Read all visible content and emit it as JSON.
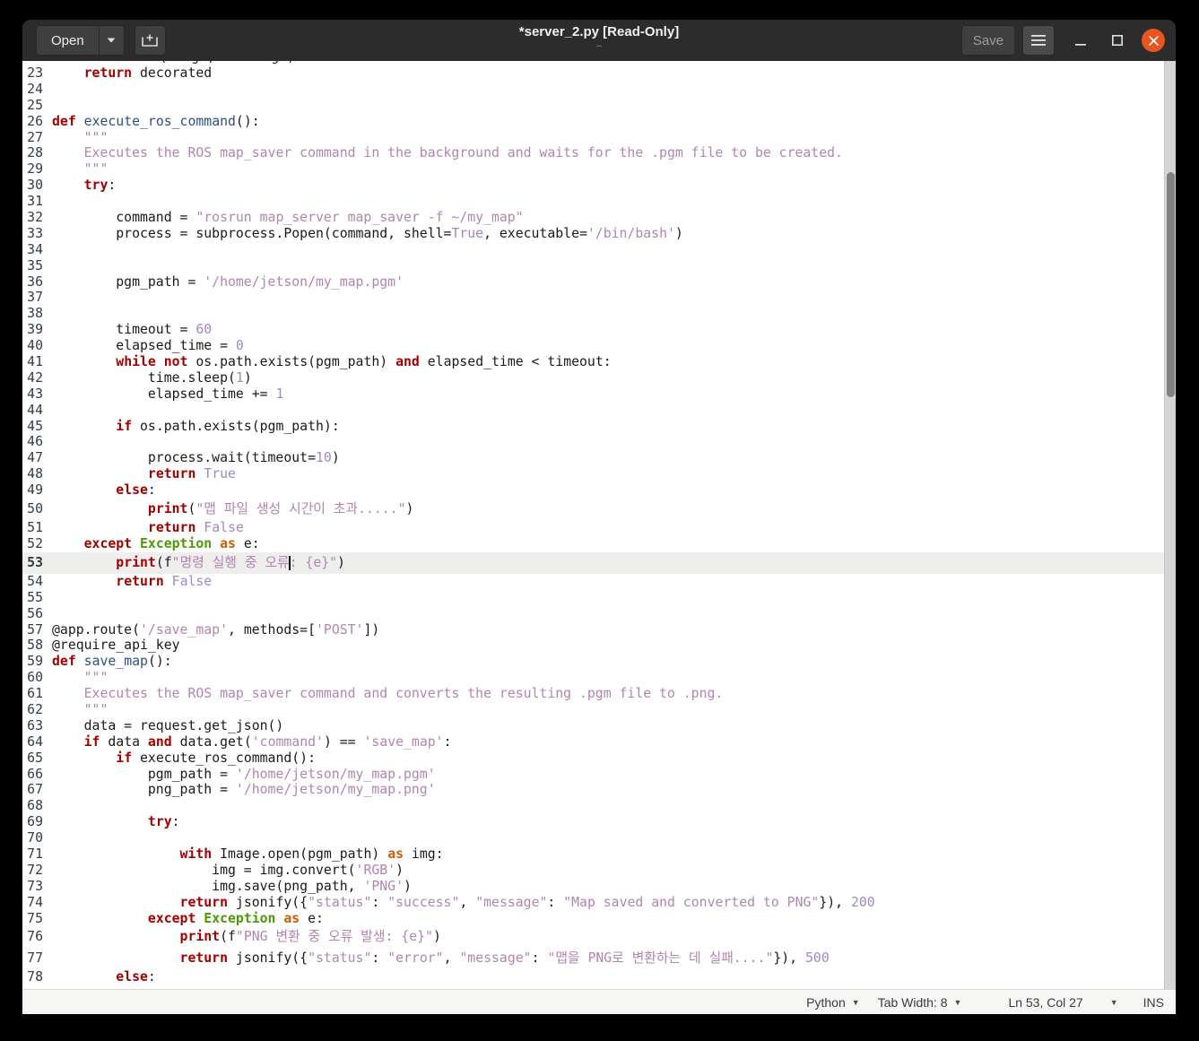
{
  "window": {
    "title": "*server_2.py [Read-Only]",
    "subtitle": "~"
  },
  "titlebar": {
    "open_label": "Open",
    "save_label": "Save"
  },
  "statusbar": {
    "language": "Python",
    "tab_width": "Tab Width: 8",
    "position": "Ln 53, Col 27",
    "mode": "INS"
  },
  "colors": {
    "titlebar_bg": "#2c2c2c",
    "close_button": "#e95420",
    "editor_bg": "#ffffff",
    "current_line_bg": "#eeeeec",
    "keyword": "#a40000",
    "string": "#b184b1",
    "number": "#a386c6",
    "exception": "#4e9a06",
    "as_keyword": "#ce5c00",
    "function_name": "#2a4f87"
  },
  "editor": {
    "current_line": 53,
    "partial_line": {
      "toks": [
        [
          "t",
          "        "
        ],
        [
          "k",
          "return"
        ],
        [
          "t",
          " f(*args, **kwargs)"
        ]
      ]
    },
    "lines": [
      {
        "n": 23,
        "toks": [
          [
            "t",
            "    "
          ],
          [
            "k",
            "return"
          ],
          [
            "t",
            " decorated"
          ]
        ]
      },
      {
        "n": 24,
        "toks": []
      },
      {
        "n": 25,
        "toks": []
      },
      {
        "n": 26,
        "toks": [
          [
            "k",
            "def"
          ],
          [
            "t",
            " "
          ],
          [
            "f",
            "execute_ros_command"
          ],
          [
            "t",
            "():"
          ]
        ]
      },
      {
        "n": 27,
        "toks": [
          [
            "t",
            "    "
          ],
          [
            "s",
            "\"\"\""
          ]
        ]
      },
      {
        "n": 28,
        "toks": [
          [
            "t",
            "    "
          ],
          [
            "s",
            "Executes the ROS map_saver command in the background and waits for the .pgm file to be created."
          ]
        ]
      },
      {
        "n": 29,
        "toks": [
          [
            "t",
            "    "
          ],
          [
            "s",
            "\"\"\""
          ]
        ]
      },
      {
        "n": 30,
        "toks": [
          [
            "t",
            "    "
          ],
          [
            "k",
            "try"
          ],
          [
            "t",
            ":"
          ]
        ]
      },
      {
        "n": 31,
        "toks": []
      },
      {
        "n": 32,
        "toks": [
          [
            "t",
            "        command = "
          ],
          [
            "s",
            "\"rosrun map_server map_saver -f ~/my_map\""
          ]
        ]
      },
      {
        "n": 33,
        "toks": [
          [
            "t",
            "        process = subprocess.Popen(command, shell="
          ],
          [
            "n",
            "True"
          ],
          [
            "t",
            ", executable="
          ],
          [
            "s",
            "'/bin/bash'"
          ],
          [
            "t",
            ")"
          ]
        ]
      },
      {
        "n": 34,
        "toks": []
      },
      {
        "n": 35,
        "toks": []
      },
      {
        "n": 36,
        "toks": [
          [
            "t",
            "        pgm_path = "
          ],
          [
            "s",
            "'/home/jetson/my_map.pgm'"
          ]
        ]
      },
      {
        "n": 37,
        "toks": []
      },
      {
        "n": 38,
        "toks": []
      },
      {
        "n": 39,
        "toks": [
          [
            "t",
            "        timeout = "
          ],
          [
            "n",
            "60"
          ]
        ]
      },
      {
        "n": 40,
        "toks": [
          [
            "t",
            "        elapsed_time = "
          ],
          [
            "n",
            "0"
          ]
        ]
      },
      {
        "n": 41,
        "toks": [
          [
            "t",
            "        "
          ],
          [
            "k",
            "while"
          ],
          [
            "t",
            " "
          ],
          [
            "k",
            "not"
          ],
          [
            "t",
            " os.path.exists(pgm_path) "
          ],
          [
            "k",
            "and"
          ],
          [
            "t",
            " elapsed_time < timeout:"
          ]
        ]
      },
      {
        "n": 42,
        "toks": [
          [
            "t",
            "            time.sleep("
          ],
          [
            "n",
            "1"
          ],
          [
            "t",
            ")"
          ]
        ]
      },
      {
        "n": 43,
        "toks": [
          [
            "t",
            "            elapsed_time += "
          ],
          [
            "n",
            "1"
          ]
        ]
      },
      {
        "n": 44,
        "toks": []
      },
      {
        "n": 45,
        "toks": [
          [
            "t",
            "        "
          ],
          [
            "k",
            "if"
          ],
          [
            "t",
            " os.path.exists(pgm_path):"
          ]
        ]
      },
      {
        "n": 46,
        "toks": []
      },
      {
        "n": 47,
        "toks": [
          [
            "t",
            "            process.wait(timeout="
          ],
          [
            "n",
            "10"
          ],
          [
            "t",
            ")"
          ]
        ]
      },
      {
        "n": 48,
        "toks": [
          [
            "t",
            "            "
          ],
          [
            "k",
            "return"
          ],
          [
            "t",
            " "
          ],
          [
            "n",
            "True"
          ]
        ]
      },
      {
        "n": 49,
        "toks": [
          [
            "t",
            "        "
          ],
          [
            "k",
            "else"
          ],
          [
            "t",
            ":"
          ]
        ]
      },
      {
        "n": 50,
        "tall": true,
        "toks": [
          [
            "t",
            "            "
          ],
          [
            "k",
            "print"
          ],
          [
            "t",
            "("
          ],
          [
            "s",
            "\"맵 파일 생성 시간이 초과.....\""
          ],
          [
            "t",
            ")"
          ]
        ]
      },
      {
        "n": 51,
        "toks": [
          [
            "t",
            "            "
          ],
          [
            "k",
            "return"
          ],
          [
            "t",
            " "
          ],
          [
            "n",
            "False"
          ]
        ]
      },
      {
        "n": 52,
        "toks": [
          [
            "t",
            "    "
          ],
          [
            "k",
            "except"
          ],
          [
            "t",
            " "
          ],
          [
            "e",
            "Exception"
          ],
          [
            "t",
            " "
          ],
          [
            "a",
            "as"
          ],
          [
            "t",
            " e:"
          ]
        ]
      },
      {
        "n": 53,
        "tall": true,
        "toks": [
          [
            "t",
            "        "
          ],
          [
            "k",
            "print"
          ],
          [
            "t",
            "(f"
          ],
          [
            "s",
            "\"명령 실행 중 오류"
          ],
          [
            "c",
            ""
          ],
          [
            "s",
            ": {e}\""
          ],
          [
            "t",
            ")"
          ]
        ]
      },
      {
        "n": 54,
        "toks": [
          [
            "t",
            "        "
          ],
          [
            "k",
            "return"
          ],
          [
            "t",
            " "
          ],
          [
            "n",
            "False"
          ]
        ]
      },
      {
        "n": 55,
        "toks": []
      },
      {
        "n": 56,
        "toks": []
      },
      {
        "n": 57,
        "toks": [
          [
            "t",
            "@app.route("
          ],
          [
            "s",
            "'/save_map'"
          ],
          [
            "t",
            ", methods=["
          ],
          [
            "s",
            "'POST'"
          ],
          [
            "t",
            "])"
          ]
        ]
      },
      {
        "n": 58,
        "toks": [
          [
            "t",
            "@require_api_key"
          ]
        ]
      },
      {
        "n": 59,
        "toks": [
          [
            "k",
            "def"
          ],
          [
            "t",
            " "
          ],
          [
            "f",
            "save_map"
          ],
          [
            "t",
            "():"
          ]
        ]
      },
      {
        "n": 60,
        "toks": [
          [
            "t",
            "    "
          ],
          [
            "s",
            "\"\"\""
          ]
        ]
      },
      {
        "n": 61,
        "toks": [
          [
            "t",
            "    "
          ],
          [
            "s",
            "Executes the ROS map_saver command and converts the resulting .pgm file to .png."
          ]
        ]
      },
      {
        "n": 62,
        "toks": [
          [
            "t",
            "    "
          ],
          [
            "s",
            "\"\"\""
          ]
        ]
      },
      {
        "n": 63,
        "toks": [
          [
            "t",
            "    data = request.get_json()"
          ]
        ]
      },
      {
        "n": 64,
        "toks": [
          [
            "t",
            "    "
          ],
          [
            "k",
            "if"
          ],
          [
            "t",
            " data "
          ],
          [
            "k",
            "and"
          ],
          [
            "t",
            " data.get("
          ],
          [
            "s",
            "'command'"
          ],
          [
            "t",
            ") == "
          ],
          [
            "s",
            "'save_map'"
          ],
          [
            "t",
            ":"
          ]
        ]
      },
      {
        "n": 65,
        "toks": [
          [
            "t",
            "        "
          ],
          [
            "k",
            "if"
          ],
          [
            "t",
            " execute_ros_command():"
          ]
        ]
      },
      {
        "n": 66,
        "toks": [
          [
            "t",
            "            pgm_path = "
          ],
          [
            "s",
            "'/home/jetson/my_map.pgm'"
          ]
        ]
      },
      {
        "n": 67,
        "toks": [
          [
            "t",
            "            png_path = "
          ],
          [
            "s",
            "'/home/jetson/my_map.png'"
          ]
        ]
      },
      {
        "n": 68,
        "toks": []
      },
      {
        "n": 69,
        "toks": [
          [
            "t",
            "            "
          ],
          [
            "k",
            "try"
          ],
          [
            "t",
            ":"
          ]
        ]
      },
      {
        "n": 70,
        "toks": []
      },
      {
        "n": 71,
        "toks": [
          [
            "t",
            "                "
          ],
          [
            "k",
            "with"
          ],
          [
            "t",
            " Image.open(pgm_path) "
          ],
          [
            "a",
            "as"
          ],
          [
            "t",
            " img:"
          ]
        ]
      },
      {
        "n": 72,
        "toks": [
          [
            "t",
            "                    img = img.convert("
          ],
          [
            "s",
            "'RGB'"
          ],
          [
            "t",
            ")"
          ]
        ]
      },
      {
        "n": 73,
        "toks": [
          [
            "t",
            "                    img.save(png_path, "
          ],
          [
            "s",
            "'PNG'"
          ],
          [
            "t",
            ")"
          ]
        ]
      },
      {
        "n": 74,
        "toks": [
          [
            "t",
            "                "
          ],
          [
            "k",
            "return"
          ],
          [
            "t",
            " jsonify({"
          ],
          [
            "s",
            "\"status\""
          ],
          [
            "t",
            ": "
          ],
          [
            "s",
            "\"success\""
          ],
          [
            "t",
            ", "
          ],
          [
            "s",
            "\"message\""
          ],
          [
            "t",
            ": "
          ],
          [
            "s",
            "\"Map saved and converted to PNG\""
          ],
          [
            "t",
            "}), "
          ],
          [
            "n",
            "200"
          ]
        ]
      },
      {
        "n": 75,
        "toks": [
          [
            "t",
            "            "
          ],
          [
            "k",
            "except"
          ],
          [
            "t",
            " "
          ],
          [
            "e",
            "Exception"
          ],
          [
            "t",
            " "
          ],
          [
            "a",
            "as"
          ],
          [
            "t",
            " e:"
          ]
        ]
      },
      {
        "n": 76,
        "tall": true,
        "toks": [
          [
            "t",
            "                "
          ],
          [
            "k",
            "print"
          ],
          [
            "t",
            "(f"
          ],
          [
            "s",
            "\"PNG 변환 중 오류 발생: {e}\""
          ],
          [
            "t",
            ")"
          ]
        ]
      },
      {
        "n": 77,
        "tall": true,
        "toks": [
          [
            "t",
            "                "
          ],
          [
            "k",
            "return"
          ],
          [
            "t",
            " jsonify({"
          ],
          [
            "s",
            "\"status\""
          ],
          [
            "t",
            ": "
          ],
          [
            "s",
            "\"error\""
          ],
          [
            "t",
            ", "
          ],
          [
            "s",
            "\"message\""
          ],
          [
            "t",
            ": "
          ],
          [
            "s",
            "\"맵을 PNG로 변환하는 데 실패....\""
          ],
          [
            "t",
            "}), "
          ],
          [
            "n",
            "500"
          ]
        ]
      },
      {
        "n": 78,
        "toks": [
          [
            "t",
            "        "
          ],
          [
            "k",
            "else"
          ],
          [
            "t",
            ":"
          ]
        ]
      }
    ]
  }
}
